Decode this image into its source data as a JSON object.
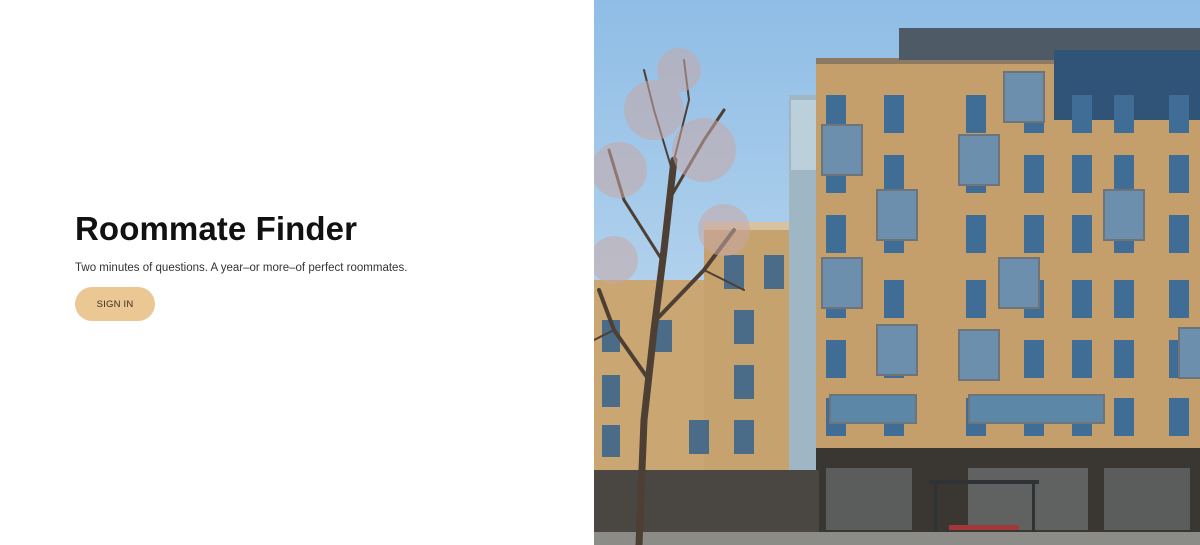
{
  "hero": {
    "title": "Roommate Finder",
    "subtitle": "Two minutes of questions. A year–or more–of perfect roommates.",
    "signin_label": "SIGN IN"
  },
  "image": {
    "subject": "apartment-building-photo"
  },
  "colors": {
    "accent": "#ebc794",
    "sky": "#a9cdea",
    "brick": "#c4a06d",
    "window": "#3f6d95"
  }
}
